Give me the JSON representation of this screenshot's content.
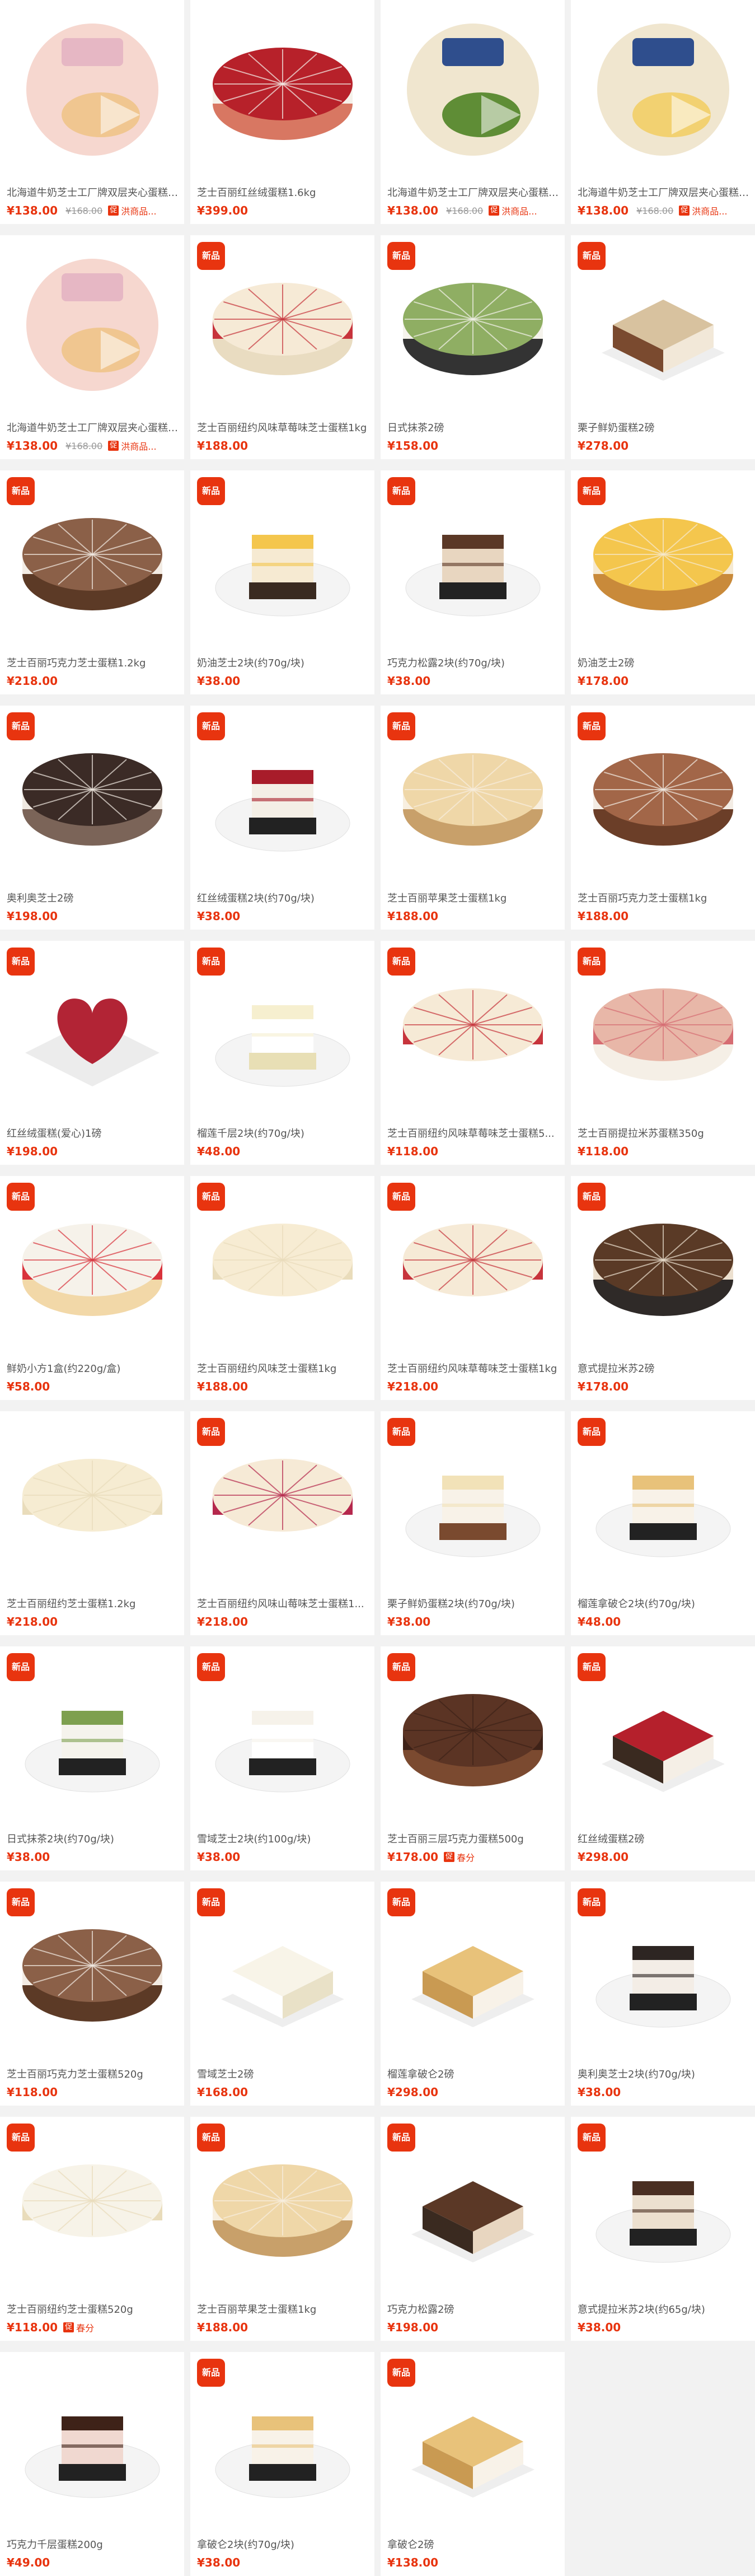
{
  "colors": {
    "accent": "#e8340f",
    "background": "#f2f2f2",
    "card": "#ffffff"
  },
  "products": [
    {
      "title": "北海道牛奶芝士工厂牌双层夹心蛋糕1kg",
      "price": "¥138.00",
      "orig": "¥168.00",
      "tag": "促",
      "tagtext": "洪商品...",
      "new": false,
      "icon": "cake-box-icon",
      "colors": [
        "#f6d7cf",
        "#f0c690",
        "#e6b7c4"
      ]
    },
    {
      "title": "芝士百丽红丝绒蛋糕1.6kg",
      "price": "¥399.00",
      "orig": "",
      "tag": "",
      "tagtext": "",
      "new": false,
      "icon": "red-velvet-cake-icon",
      "colors": [
        "#b7212a",
        "#f5f1ea",
        "#d87762"
      ]
    },
    {
      "title": "北海道牛奶芝士工厂牌双层夹心蛋糕1kg",
      "price": "¥138.00",
      "orig": "¥168.00",
      "tag": "促",
      "tagtext": "洪商品...",
      "new": false,
      "icon": "matcha-cake-box-icon",
      "colors": [
        "#f0e6cf",
        "#5f8d36",
        "#2f4e8d"
      ]
    },
    {
      "title": "北海道牛奶芝士工厂牌双层夹心蛋糕1kg",
      "price": "¥138.00",
      "orig": "¥168.00",
      "tag": "促",
      "tagtext": "洪商品...",
      "new": false,
      "icon": "cheese-cake-box-icon",
      "colors": [
        "#f0e6cf",
        "#f2d171",
        "#2f4e8d"
      ]
    },
    {
      "title": "北海道牛奶芝士工厂牌双层夹心蛋糕1kg",
      "price": "¥138.00",
      "orig": "¥168.00",
      "tag": "促",
      "tagtext": "洪商品...",
      "new": false,
      "icon": "cake-box-icon",
      "colors": [
        "#f6d7cf",
        "#f0c690",
        "#e6b7c4"
      ]
    },
    {
      "title": "芝士百丽纽约风味草莓味芝士蛋糕1kg",
      "price": "¥188.00",
      "orig": "",
      "tag": "",
      "tagtext": "",
      "new": true,
      "icon": "strawberry-cheesecake-icon",
      "colors": [
        "#f6ead6",
        "#c7343c",
        "#e9dcc1"
      ]
    },
    {
      "title": "日式抹茶2磅",
      "price": "¥158.00",
      "orig": "",
      "tag": "",
      "tagtext": "",
      "new": true,
      "icon": "matcha-cake-icon",
      "colors": [
        "#8fae63",
        "#f5f3ec",
        "#333333"
      ]
    },
    {
      "title": "栗子鲜奶蛋糕2磅",
      "price": "¥278.00",
      "orig": "",
      "tag": "",
      "tagtext": "",
      "new": true,
      "icon": "chestnut-cake-icon",
      "colors": [
        "#d8c29f",
        "#f2e8d8",
        "#7a4a2f"
      ]
    },
    {
      "title": "芝士百丽巧克力芝士蛋糕1.2kg",
      "price": "¥218.00",
      "orig": "",
      "tag": "",
      "tagtext": "",
      "new": true,
      "icon": "chocolate-cheesecake-icon",
      "colors": [
        "#8b6048",
        "#f3ece4",
        "#5c3a26"
      ]
    },
    {
      "title": "奶油芝士2块(约70g/块)",
      "price": "¥38.00",
      "orig": "",
      "tag": "",
      "tagtext": "",
      "new": true,
      "icon": "cheese-slice-icon",
      "colors": [
        "#f4c64d",
        "#f6ead2",
        "#3a2a20"
      ]
    },
    {
      "title": "巧克力松露2块(约70g/块)",
      "price": "¥38.00",
      "orig": "",
      "tag": "",
      "tagtext": "",
      "new": true,
      "icon": "truffle-slice-icon",
      "colors": [
        "#5b3826",
        "#e8d6c0",
        "#222222"
      ]
    },
    {
      "title": "奶油芝士2磅",
      "price": "¥178.00",
      "orig": "",
      "tag": "",
      "tagtext": "",
      "new": true,
      "icon": "cheese-cake-icon",
      "colors": [
        "#f4c64d",
        "#f6ead2",
        "#c98a3a"
      ]
    },
    {
      "title": "奥利奥芝士2磅",
      "price": "¥198.00",
      "orig": "",
      "tag": "",
      "tagtext": "",
      "new": true,
      "icon": "oreo-cake-icon",
      "colors": [
        "#3b2b26",
        "#efe8e0",
        "#7b6458"
      ]
    },
    {
      "title": "红丝绒蛋糕2块(约70g/块)",
      "price": "¥38.00",
      "orig": "",
      "tag": "",
      "tagtext": "",
      "new": true,
      "icon": "red-velvet-slice-icon",
      "colors": [
        "#a81c2a",
        "#f4efe6",
        "#222222"
      ]
    },
    {
      "title": "芝士百丽苹果芝士蛋糕1kg",
      "price": "¥188.00",
      "orig": "",
      "tag": "",
      "tagtext": "",
      "new": true,
      "icon": "apple-cheesecake-icon",
      "colors": [
        "#efd7a8",
        "#f8efe0",
        "#c8a06a"
      ]
    },
    {
      "title": "芝士百丽巧克力芝士蛋糕1kg",
      "price": "¥188.00",
      "orig": "",
      "tag": "",
      "tagtext": "",
      "new": true,
      "icon": "chocolate-cheesecake-icon",
      "colors": [
        "#a26648",
        "#f3ece4",
        "#6b3e28"
      ]
    },
    {
      "title": "红丝绒蛋糕(爱心)1磅",
      "price": "¥198.00",
      "orig": "",
      "tag": "",
      "tagtext": "",
      "new": true,
      "icon": "heart-cake-icon",
      "colors": [
        "#b22435",
        "#f5efe6",
        "#ececec"
      ]
    },
    {
      "title": "榴莲千层2块(约70g/块)",
      "price": "¥48.00",
      "orig": "",
      "tag": "",
      "tagtext": "",
      "new": true,
      "icon": "crepe-slice-icon",
      "colors": [
        "#f6efcf",
        "#ffffff",
        "#e8dfb5"
      ]
    },
    {
      "title": "芝士百丽纽约风味草莓味芝士蛋糕5...",
      "price": "¥118.00",
      "orig": "",
      "tag": "",
      "tagtext": "",
      "new": true,
      "icon": "strawberry-cheesecake-icon",
      "colors": [
        "#f6ead6",
        "#c7343c",
        "#ffffff"
      ]
    },
    {
      "title": "芝士百丽提拉米苏蛋糕350g",
      "price": "¥118.00",
      "orig": "",
      "tag": "",
      "tagtext": "",
      "new": true,
      "icon": "rose-cake-icon",
      "colors": [
        "#e8b7a8",
        "#d66c72",
        "#f5efe6"
      ]
    },
    {
      "title": "鲜奶小方1盒(约220g/盒)",
      "price": "¥58.00",
      "orig": "",
      "tag": "",
      "tagtext": "",
      "new": true,
      "icon": "strawberry-cake-icon",
      "colors": [
        "#f6f2ea",
        "#d9333c",
        "#f2d8a8"
      ]
    },
    {
      "title": "芝士百丽纽约风味芝士蛋糕1kg",
      "price": "¥188.00",
      "orig": "",
      "tag": "",
      "tagtext": "",
      "new": true,
      "icon": "plain-cheesecake-icon",
      "colors": [
        "#f7ecd3",
        "#e9dcbb",
        "#ffffff"
      ]
    },
    {
      "title": "芝士百丽纽约风味草莓味芝士蛋糕1kg",
      "price": "¥218.00",
      "orig": "",
      "tag": "",
      "tagtext": "",
      "new": true,
      "icon": "strawberry-cheesecake-icon",
      "colors": [
        "#f6ead6",
        "#c7343c",
        "#ffffff"
      ]
    },
    {
      "title": "意式提拉米苏2磅",
      "price": "¥178.00",
      "orig": "",
      "tag": "",
      "tagtext": "",
      "new": true,
      "icon": "tiramisu-cake-icon",
      "colors": [
        "#5a3a26",
        "#ece0cf",
        "#2f2a28"
      ]
    },
    {
      "title": "芝士百丽纽约芝士蛋糕1.2kg",
      "price": "¥218.00",
      "orig": "",
      "tag": "",
      "tagtext": "",
      "new": false,
      "icon": "plain-cheesecake-icon",
      "colors": [
        "#f6ecd2",
        "#e9dcbb",
        "#ffffff"
      ]
    },
    {
      "title": "芝士百丽纽约风味山莓味芝士蛋糕1...",
      "price": "¥218.00",
      "orig": "",
      "tag": "",
      "tagtext": "",
      "new": true,
      "icon": "raspberry-cheesecake-icon",
      "colors": [
        "#f6ead6",
        "#b5284d",
        "#ffffff"
      ]
    },
    {
      "title": "栗子鲜奶蛋糕2块(约70g/块)",
      "price": "¥38.00",
      "orig": "",
      "tag": "",
      "tagtext": "",
      "new": true,
      "icon": "chestnut-slice-icon",
      "colors": [
        "#f2e2b8",
        "#f8f2e8",
        "#7a4a2f"
      ]
    },
    {
      "title": "榴莲拿破仑2块(约70g/块)",
      "price": "¥48.00",
      "orig": "",
      "tag": "",
      "tagtext": "",
      "new": true,
      "icon": "napoleon-slice-icon",
      "colors": [
        "#e8c27a",
        "#f8f2e8",
        "#222222"
      ]
    },
    {
      "title": "日式抹茶2块(约70g/块)",
      "price": "¥38.00",
      "orig": "",
      "tag": "",
      "tagtext": "",
      "new": true,
      "icon": "matcha-slice-icon",
      "colors": [
        "#7ea04f",
        "#f5f3ec",
        "#222222"
      ]
    },
    {
      "title": "雪域芝士2块(约100g/块)",
      "price": "¥38.00",
      "orig": "",
      "tag": "",
      "tagtext": "",
      "new": true,
      "icon": "snow-cheese-slice-icon",
      "colors": [
        "#f6f2ea",
        "#ffffff",
        "#222222"
      ]
    },
    {
      "title": "芝士百丽三层巧克力蛋糕500g",
      "price": "¥178.00",
      "orig": "",
      "tag": "促",
      "tagtext": "春分",
      "new": true,
      "icon": "chocolate-cake-icon",
      "colors": [
        "#5b3424",
        "#3e2218",
        "#7b4a30"
      ]
    },
    {
      "title": "红丝绒蛋糕2磅",
      "price": "¥298.00",
      "orig": "",
      "tag": "",
      "tagtext": "",
      "new": true,
      "icon": "red-velvet-square-icon",
      "colors": [
        "#b5202c",
        "#f5efe6",
        "#3a2a20"
      ]
    },
    {
      "title": "芝士百丽巧克力芝士蛋糕520g",
      "price": "¥118.00",
      "orig": "",
      "tag": "",
      "tagtext": "",
      "new": true,
      "icon": "chocolate-cheesecake-icon",
      "colors": [
        "#8b6048",
        "#f3ece4",
        "#5c3a26"
      ]
    },
    {
      "title": "雪域芝士2磅",
      "price": "¥168.00",
      "orig": "",
      "tag": "",
      "tagtext": "",
      "new": true,
      "icon": "snow-cheese-cake-icon",
      "colors": [
        "#f8f4e8",
        "#e9e1c7",
        "#ffffff"
      ]
    },
    {
      "title": "榴莲拿破仑2磅",
      "price": "¥298.00",
      "orig": "",
      "tag": "",
      "tagtext": "",
      "new": true,
      "icon": "napoleon-cake-icon",
      "colors": [
        "#e8c27a",
        "#f8f2e8",
        "#c99a52"
      ]
    },
    {
      "title": "奥利奥芝士2块(约70g/块)",
      "price": "¥38.00",
      "orig": "",
      "tag": "",
      "tagtext": "",
      "new": true,
      "icon": "oreo-slice-icon",
      "colors": [
        "#2d2522",
        "#f3ede6",
        "#222222"
      ]
    },
    {
      "title": "芝士百丽纽约芝士蛋糕520g",
      "price": "¥118.00",
      "orig": "",
      "tag": "促",
      "tagtext": "春分",
      "new": true,
      "icon": "plain-cheesecake-icon",
      "colors": [
        "#f7f3e8",
        "#e9dcbb",
        "#ffffff"
      ]
    },
    {
      "title": "芝士百丽苹果芝士蛋糕1kg",
      "price": "¥188.00",
      "orig": "",
      "tag": "",
      "tagtext": "",
      "new": true,
      "icon": "apple-cheesecake-icon",
      "colors": [
        "#efd7a8",
        "#f8efe0",
        "#c8a06a"
      ]
    },
    {
      "title": "巧克力松露2磅",
      "price": "¥198.00",
      "orig": "",
      "tag": "",
      "tagtext": "",
      "new": true,
      "icon": "truffle-cake-icon",
      "colors": [
        "#5b3826",
        "#e8d6c0",
        "#3a2a20"
      ]
    },
    {
      "title": "意式提拉米苏2块(约65g/块)",
      "price": "¥38.00",
      "orig": "",
      "tag": "",
      "tagtext": "",
      "new": true,
      "icon": "tiramisu-slice-icon",
      "colors": [
        "#4a2f22",
        "#ece0cf",
        "#222222"
      ]
    },
    {
      "title": "巧克力千层蛋糕200g",
      "price": "¥49.00",
      "orig": "",
      "tag": "",
      "tagtext": "",
      "new": false,
      "icon": "chocolate-crepe-icon",
      "colors": [
        "#3e2218",
        "#f0d8d0",
        "#222222"
      ]
    },
    {
      "title": "拿破仑2块(约70g/块)",
      "price": "¥38.00",
      "orig": "",
      "tag": "",
      "tagtext": "",
      "new": true,
      "icon": "napoleon-slice-icon",
      "colors": [
        "#e8c27a",
        "#f8f2e8",
        "#222222"
      ]
    },
    {
      "title": "拿破仑2磅",
      "price": "¥138.00",
      "orig": "",
      "tag": "",
      "tagtext": "",
      "new": true,
      "icon": "napoleon-cake-icon",
      "colors": [
        "#e8c27a",
        "#f8f2e8",
        "#c99a52"
      ]
    }
  ],
  "badge_label": "新品"
}
